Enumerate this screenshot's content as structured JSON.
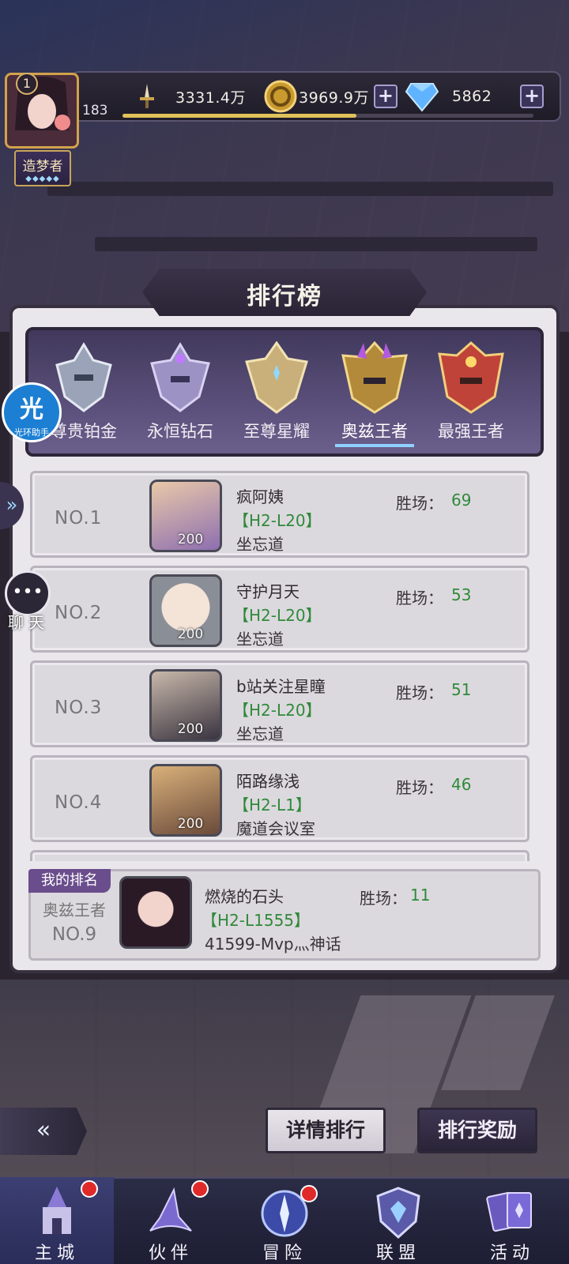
{
  "header": {
    "player_rank_level": "1",
    "player_level": "183",
    "player_title": "造梦者",
    "title_stars": "◆◆◆◆◆",
    "exp_progress": 0.57,
    "power_value": "3331.4万",
    "gold_value": "3969.9万",
    "diamond_value": "5862",
    "plus_symbol": "+"
  },
  "panel": {
    "title": "排行榜",
    "tabs": [
      {
        "label": "尊贵铂金"
      },
      {
        "label": "永恒钻石"
      },
      {
        "label": "至尊星耀"
      },
      {
        "label": "奥兹王者",
        "active": true
      },
      {
        "label": "最强王者"
      }
    ],
    "win_label": "胜场：",
    "rows": [
      {
        "no": "NO.1",
        "name": "疯阿姨",
        "server": "【H2-L20】",
        "guild": "坐忘道",
        "wins": "69",
        "portrait_num": "200"
      },
      {
        "no": "NO.2",
        "name": "守护月天",
        "server": "【H2-L20】",
        "guild": "坐忘道",
        "wins": "53",
        "portrait_num": "200"
      },
      {
        "no": "NO.3",
        "name": "b站关注星瞳",
        "server": "【H2-L20】",
        "guild": "坐忘道",
        "wins": "51",
        "portrait_num": "200"
      },
      {
        "no": "NO.4",
        "name": "陌路缘浅",
        "server": "【H2-L1】",
        "guild": "魔道会议室",
        "wins": "46",
        "portrait_num": "200"
      }
    ],
    "my_rank": {
      "tag": "我的排名",
      "tier": "奥兹王者",
      "no": "NO.9",
      "name": "燃烧的石头",
      "server": "【H2-L1555】",
      "guild": "41599-Mvp灬神话",
      "wins": "11"
    }
  },
  "side": {
    "assistant_big": "光",
    "assistant_small": "光环助手",
    "expand_arrow": "»",
    "chat_icon": "•••",
    "chat_label": "聊 天"
  },
  "actions": {
    "back_icon": "«",
    "detail_ranking": "详情排行",
    "ranking_rewards": "排行奖励"
  },
  "nav": [
    {
      "label": "主城",
      "active": true,
      "badge": true
    },
    {
      "label": "伙伴",
      "badge": true
    },
    {
      "label": "冒险",
      "badge": true
    },
    {
      "label": "联盟"
    },
    {
      "label": "活动"
    }
  ],
  "colors": {
    "accent_green": "#2f8a3a",
    "badge_red": "#e02a2a",
    "tab_active_underline": "#8fd0ff"
  }
}
